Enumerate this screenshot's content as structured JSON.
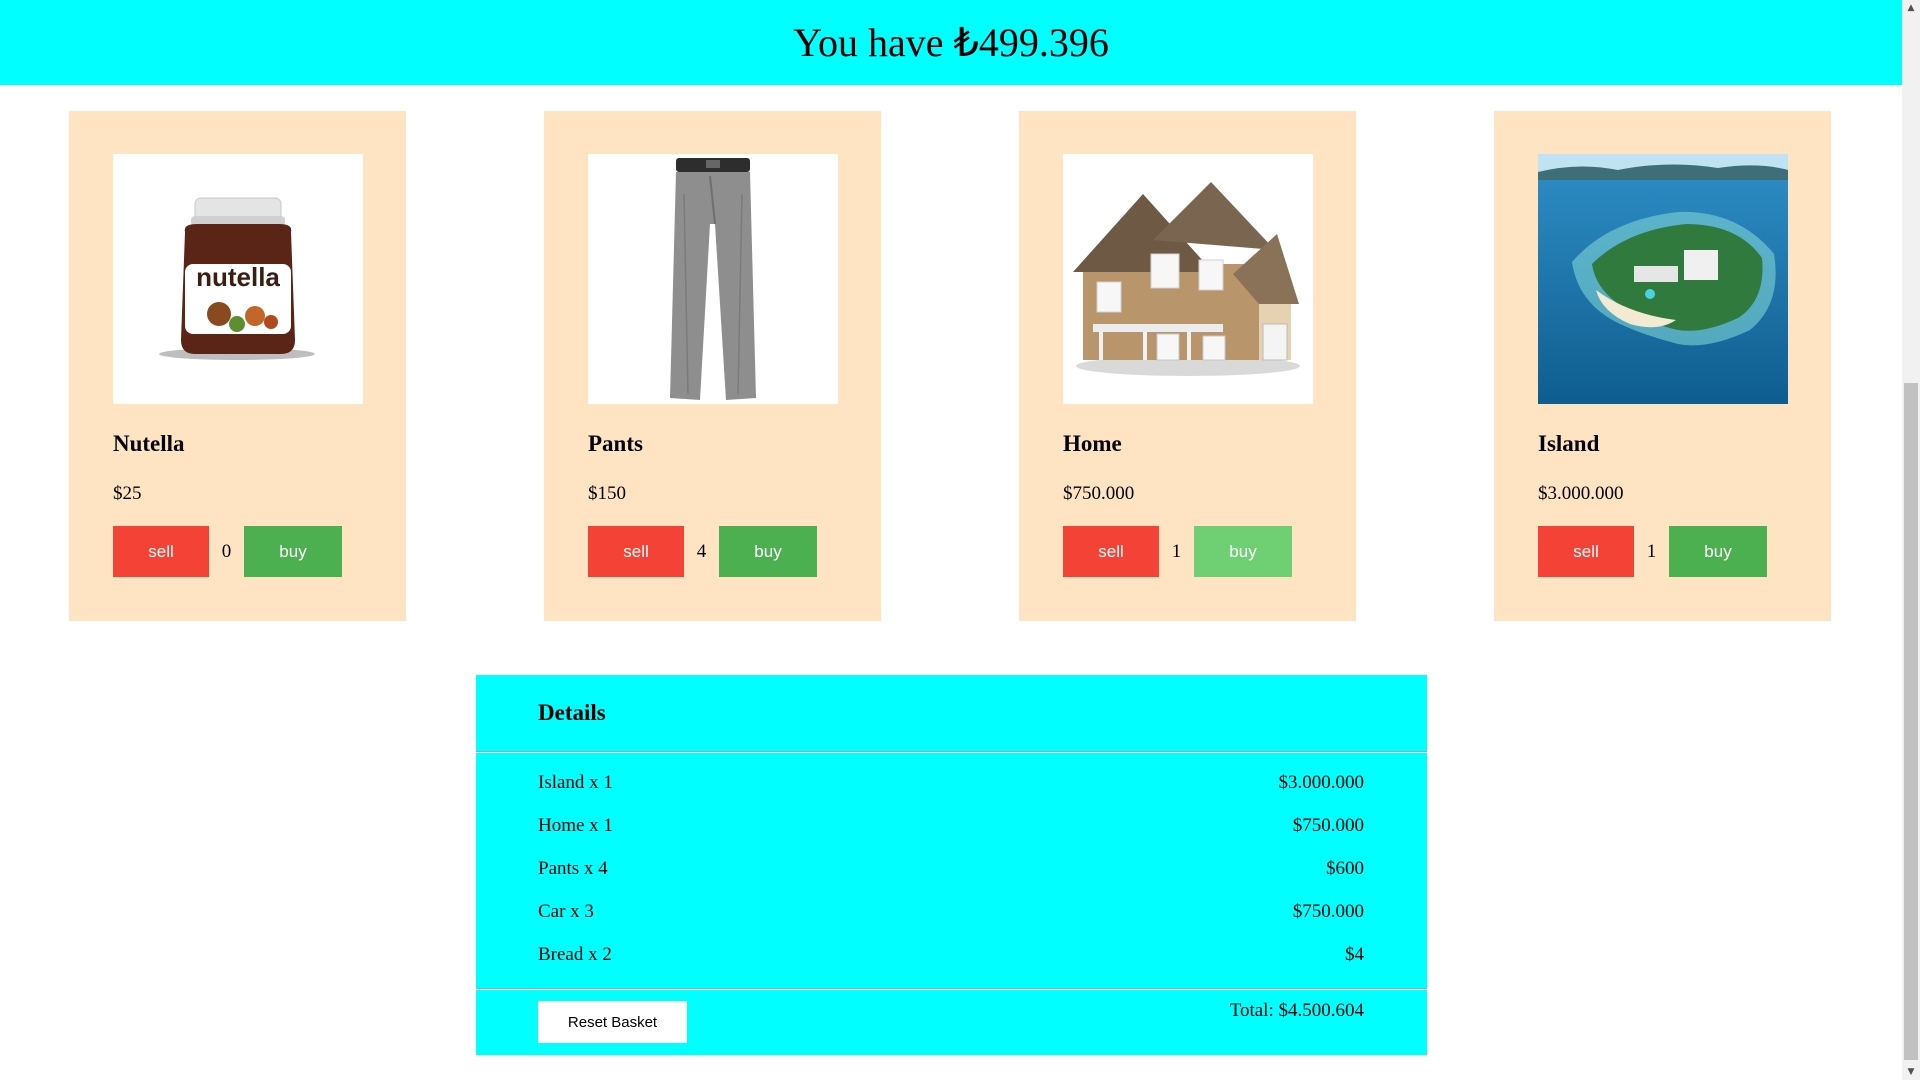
{
  "header": {
    "title": "You have ₺499.396"
  },
  "products": [
    {
      "name": "Nutella",
      "price": "$25",
      "quantity": "0",
      "sell_label": "sell",
      "buy_label": "buy",
      "image": "nutella-jar-image"
    },
    {
      "name": "Pants",
      "price": "$150",
      "quantity": "4",
      "sell_label": "sell",
      "buy_label": "buy",
      "image": "grey-pants-image"
    },
    {
      "name": "Home",
      "price": "$750.000",
      "quantity": "1",
      "sell_label": "sell",
      "buy_label": "buy",
      "image": "house-image"
    },
    {
      "name": "Island",
      "price": "$3.000.000",
      "quantity": "1",
      "sell_label": "sell",
      "buy_label": "buy",
      "image": "island-aerial-image"
    }
  ],
  "details": {
    "title": "Details",
    "rows": [
      {
        "label": "Island x 1",
        "amount": "$3.000.000"
      },
      {
        "label": "Home x 1",
        "amount": "$750.000"
      },
      {
        "label": "Pants x 4",
        "amount": "$600"
      },
      {
        "label": "Car x 3",
        "amount": "$750.000"
      },
      {
        "label": "Bread x 2",
        "amount": "$4"
      }
    ],
    "reset_label": "Reset Basket",
    "total": "Total: $4.500.604"
  },
  "colors": {
    "accent": "#00ffff",
    "card_bg": "#ffe4c4",
    "sell": "#f44336",
    "buy": "#4caf50",
    "buy_disabled": "#6fd073"
  }
}
